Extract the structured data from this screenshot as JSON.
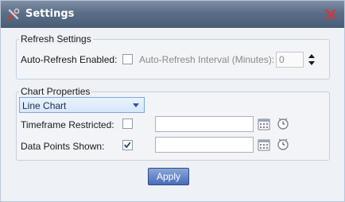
{
  "window": {
    "title": "Settings"
  },
  "refresh": {
    "legend": "Refresh Settings",
    "auto_refresh_label": "Auto-Refresh Enabled:",
    "auto_refresh_checked": false,
    "interval_label": "Auto-Refresh Interval (Minutes):",
    "interval_value": "0"
  },
  "chart": {
    "legend": "Chart Properties",
    "type_selected": "Line Chart",
    "timeframe_label": "Timeframe Restricted:",
    "timeframe_checked": false,
    "timeframe_value": "",
    "datapoints_label": "Data Points Shown:",
    "datapoints_checked": true,
    "datapoints_value": ""
  },
  "actions": {
    "apply_label": "Apply"
  },
  "colors": {
    "titlebar": "#5b6f88",
    "accent": "#4a6cb8",
    "close": "#d9343a"
  }
}
